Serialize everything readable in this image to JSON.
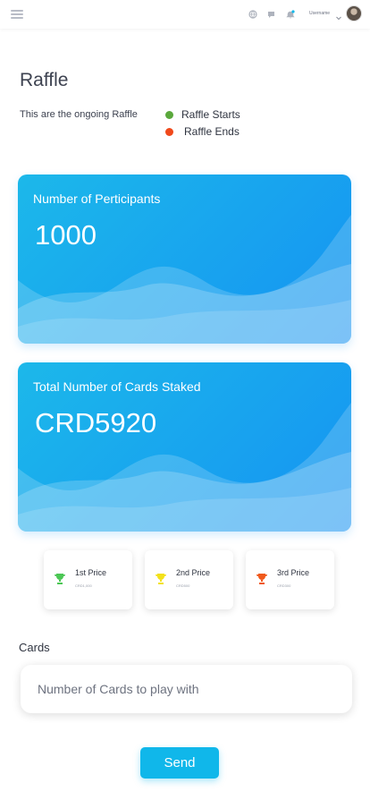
{
  "topbar": {
    "username": "Username",
    "icons": [
      "menu-icon",
      "globe-icon",
      "chat-icon",
      "bell-icon",
      "chevron-down-icon"
    ],
    "notification_dot_color": "#10b7ea"
  },
  "page": {
    "title": "Raffle",
    "subtitle": "This are the ongoing Raffle"
  },
  "legend": [
    {
      "label": "Raffle Starts",
      "color": "#5aa83c"
    },
    {
      "label": "Raffle Ends",
      "color": "#f0491b"
    }
  ],
  "stats": [
    {
      "label": "Number of Perticipants",
      "value": "1000"
    },
    {
      "label": "Total Number of Cards Staked",
      "value": "CRD5920"
    }
  ],
  "prizes": [
    {
      "name": "1st Price",
      "amount": "CRD1,000",
      "color": "#4cc755"
    },
    {
      "name": "2nd Price",
      "amount": "CRD500",
      "color": "#f3e11a"
    },
    {
      "name": "3rd Price",
      "amount": "CRD300",
      "color": "#f0591b"
    }
  ],
  "cards_section": {
    "label": "Cards",
    "placeholder": "Number of Cards to play with"
  },
  "send_button": {
    "label": "Send"
  },
  "colors": {
    "card_gradient_start": "#1cb8ea",
    "card_gradient_end": "#1593f2",
    "accent": "#10b7ea"
  }
}
